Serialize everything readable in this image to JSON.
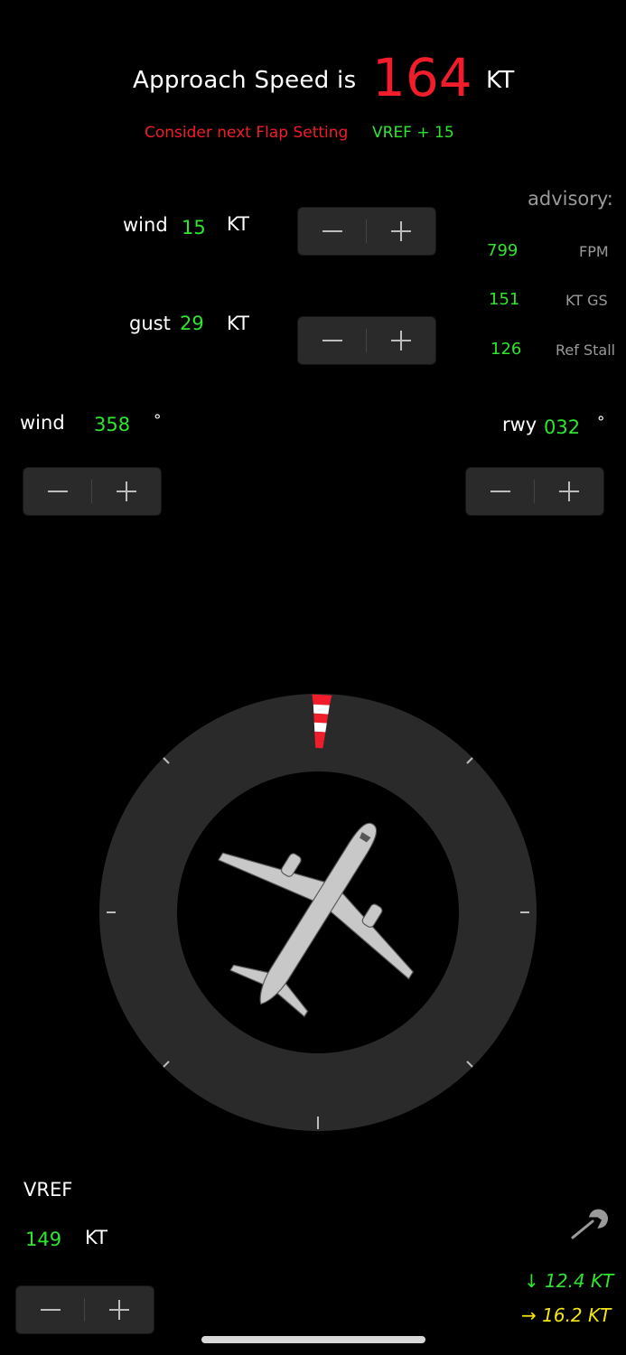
{
  "header": {
    "approach_label": "Approach Speed is",
    "approach_value": "164",
    "approach_unit": "KT",
    "flap_warning": "Consider next Flap Setting",
    "vref_offset": "VREF + 15"
  },
  "wind_speed": {
    "label": "wind",
    "value": "15",
    "unit": "KT"
  },
  "gust": {
    "label": "gust",
    "value": "29",
    "unit": "KT"
  },
  "advisory": {
    "title": "advisory:",
    "rows": [
      {
        "value": "799",
        "unit": "FPM"
      },
      {
        "value": "151",
        "unit": "KT GS"
      },
      {
        "value": "126",
        "unit": "Ref Stall"
      }
    ]
  },
  "wind_direction": {
    "label": "wind",
    "value": "358",
    "unit": "°"
  },
  "runway": {
    "label": "rwy",
    "value": "032",
    "unit": "°"
  },
  "vref": {
    "label": "VREF",
    "value": "149",
    "unit": "KT"
  },
  "components": {
    "headwind": "↓ 12.4 KT",
    "crosswind": "→ 16.2 KT"
  },
  "compass": {
    "wind_direction_deg": 358,
    "runway_heading_deg": 32
  },
  "colors": {
    "accent_green": "#2ee62e",
    "warning_red": "#f21d2a",
    "crosswind_yellow": "#f5e60c",
    "dial_gray": "#2a2a2a"
  },
  "icons": {
    "settings": "wrench-icon",
    "airplane": "airplane-icon",
    "windsock": "windsock-icon"
  }
}
